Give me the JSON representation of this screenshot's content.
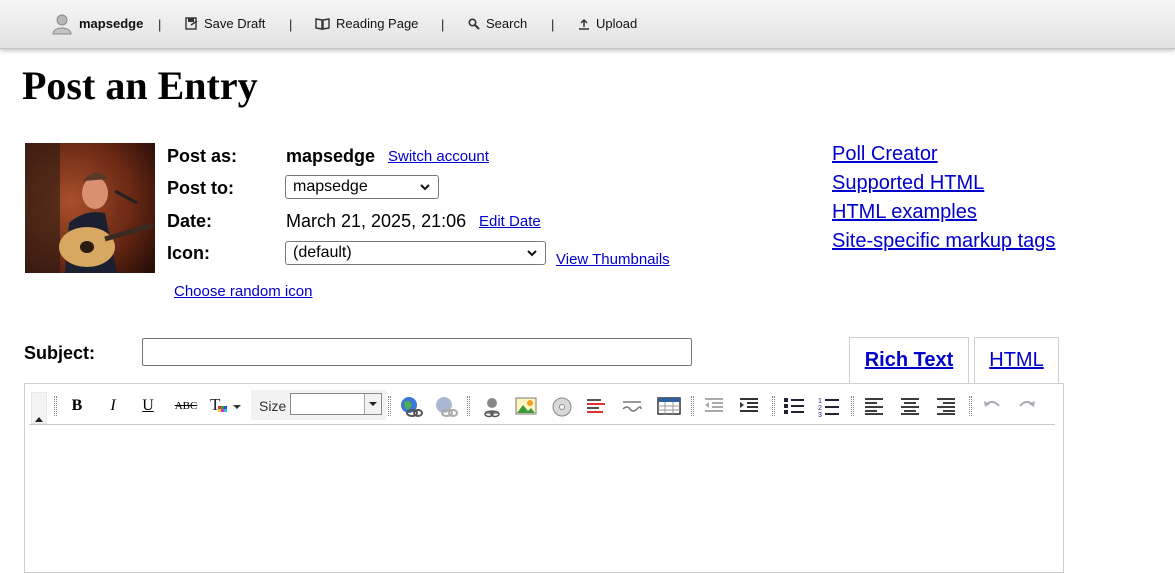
{
  "topbar": {
    "username": "mapsedge",
    "separator": "|",
    "save_draft": "Save Draft",
    "reading_page": "Reading Page",
    "search": "Search",
    "upload": "Upload"
  },
  "page_title": "Post an Entry",
  "form": {
    "post_as_label": "Post as:",
    "post_as_value": "mapsedge",
    "switch_account": "Switch account",
    "post_to_label": "Post to:",
    "post_to_value": "mapsedge",
    "date_label": "Date:",
    "date_value": "March 21, 2025, 21:06",
    "edit_date": "Edit Date",
    "icon_label": "Icon:",
    "icon_value": "(default)",
    "view_thumbnails": "View Thumbnails",
    "choose_random_icon": "Choose random icon",
    "subject_label": "Subject:",
    "subject_value": ""
  },
  "side_links": [
    "Poll Creator",
    "Supported HTML",
    "HTML examples",
    "Site-specific markup tags"
  ],
  "tabs": {
    "rich_text": "Rich Text",
    "html": "HTML"
  },
  "editor": {
    "size_label": "Size",
    "size_value": "",
    "toolbar_icons": [
      "bold-icon",
      "italic-icon",
      "underline-icon",
      "strikethrough-icon",
      "text-color-icon",
      "font-size-select",
      "link-icon",
      "unlink-icon",
      "user-icon",
      "image-icon",
      "media-icon",
      "cut-icon",
      "poll-icon",
      "table-icon",
      "outdent-icon",
      "indent-icon",
      "bulleted-list-icon",
      "numbered-list-icon",
      "align-left-icon",
      "align-center-icon",
      "align-right-icon",
      "undo-icon",
      "redo-icon"
    ]
  },
  "colors": {
    "link": "#0000cc",
    "topbar": "#e6e6e6"
  }
}
